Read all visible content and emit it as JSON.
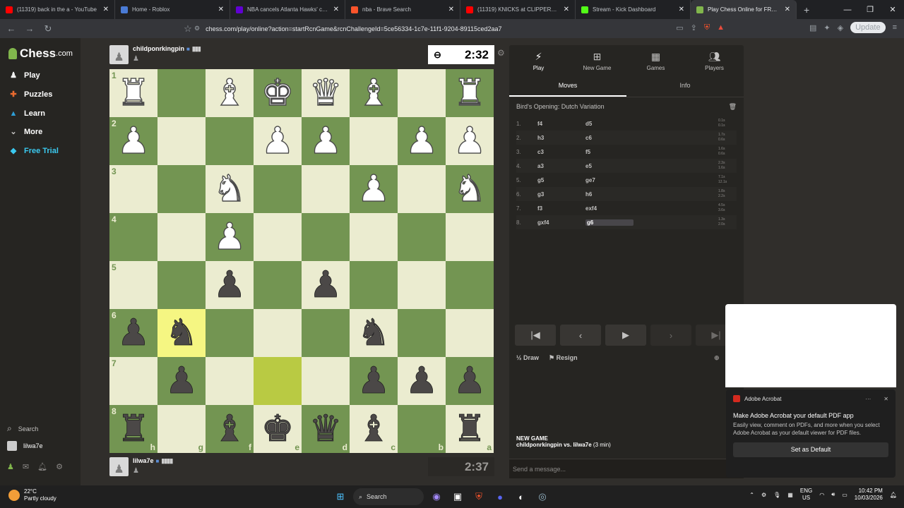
{
  "browser": {
    "tabs": [
      {
        "title": "(11319) back in the a - YouTube",
        "color": "#ff0000",
        "active": false
      },
      {
        "title": "Home - Roblox",
        "color": "#4a7bd6",
        "active": false
      },
      {
        "title": "NBA cancels Atlanta Hawks' controv",
        "color": "#6001d2",
        "active": false
      },
      {
        "title": "nba - Brave Search",
        "color": "#fb542b",
        "active": false
      },
      {
        "title": "(11319) KNICKS at CLIPPERS | FULL G",
        "color": "#ff0000",
        "active": false
      },
      {
        "title": "Stream - Kick Dashboard",
        "color": "#53fc18",
        "active": false
      },
      {
        "title": "Play Chess Online for FREE - 2 P",
        "color": "#81b64c",
        "active": true
      }
    ],
    "url": "chess.com/play/online?action=startRcnGame&rcnChallengeId=5ce56334-1c7e-11f1-9204-89115ced2aa7",
    "update_label": "Update"
  },
  "sidebar": {
    "logo": "Chess",
    "logo_suffix": ".com",
    "items": [
      {
        "label": "Play",
        "icon": "play-icon",
        "color": "#f1f1f1"
      },
      {
        "label": "Puzzles",
        "icon": "puzzle-icon",
        "color": "#e96b2f"
      },
      {
        "label": "Learn",
        "icon": "learn-icon",
        "color": "#2e9ed6"
      },
      {
        "label": "More",
        "icon": "chevron-down-icon",
        "color": "#c3c2c1"
      },
      {
        "label": "Free Trial",
        "icon": "diamond-icon",
        "color": "#3bc9ef"
      }
    ],
    "search_label": "Search",
    "user_label": "lilwa7e"
  },
  "game": {
    "top_player": {
      "name": "childponrkingpin",
      "clock": "2:32"
    },
    "bottom_player": {
      "name": "lilwa7e",
      "clock": "2:37"
    },
    "board": {
      "orientation": "black",
      "ranks": [
        "1",
        "2",
        "3",
        "4",
        "5",
        "6",
        "7",
        "8"
      ],
      "files": [
        "h",
        "g",
        "f",
        "e",
        "d",
        "c",
        "b",
        "a"
      ],
      "last_move": [
        "g6",
        "e7"
      ],
      "rows": [
        [
          "R",
          "",
          "B",
          "K",
          "Q",
          "B",
          "",
          "R"
        ],
        [
          "P",
          "",
          "",
          "P",
          "P",
          "",
          "P",
          "P"
        ],
        [
          "",
          "",
          "N",
          "",
          "",
          "P",
          "",
          "N"
        ],
        [
          "",
          "",
          "P",
          "",
          "",
          "",
          "",
          ""
        ],
        [
          "",
          "",
          "p",
          "",
          "p",
          "",
          "",
          ""
        ],
        [
          "p",
          "n",
          "",
          "",
          "",
          "n",
          "",
          ""
        ],
        [
          "",
          "p",
          "",
          "",
          "",
          "p",
          "p",
          "p"
        ],
        [
          "r",
          "",
          "b",
          "k",
          "q",
          "b",
          "",
          "r"
        ]
      ]
    }
  },
  "panel": {
    "tabs": [
      {
        "label": "Play",
        "icon": "lightning-icon"
      },
      {
        "label": "New Game",
        "icon": "plus-icon"
      },
      {
        "label": "Games",
        "icon": "board-icon"
      },
      {
        "label": "Players",
        "icon": "players-icon"
      }
    ],
    "subtabs": [
      "Moves",
      "Info"
    ],
    "opening": "Bird's Opening: Dutch Variation",
    "moves": [
      {
        "n": "1.",
        "w": "f4",
        "b": "d5",
        "t": [
          "0.1s",
          "0.1s"
        ]
      },
      {
        "n": "2.",
        "w": "h3",
        "b": "c6",
        "t": [
          "1.7s",
          "0.6s"
        ]
      },
      {
        "n": "3.",
        "w": "c3",
        "b": "f5",
        "t": [
          "1.6s",
          "0.6s"
        ]
      },
      {
        "n": "4.",
        "w": "a3",
        "b": "e5",
        "t": [
          "2.3s",
          "1.6s"
        ]
      },
      {
        "n": "5.",
        "w": "g5",
        "b": "ge7",
        "t": [
          "7.1s",
          "12.1s"
        ]
      },
      {
        "n": "6.",
        "w": "g3",
        "b": "h6",
        "t": [
          "1.8s",
          "2.2s"
        ]
      },
      {
        "n": "7.",
        "w": "f3",
        "b": "exf4",
        "t": [
          "4.5s",
          "3.6s"
        ]
      },
      {
        "n": "8.",
        "w": "gxf4",
        "b": "g6",
        "t": [
          "1.3s",
          "2.0s"
        ]
      }
    ],
    "draw_label": "Draw",
    "resign_label": "Resign",
    "new_game_title": "NEW GAME",
    "new_game_players": "childponrkingpin vs. lilwa7e",
    "new_game_time": "(3 min)",
    "message_placeholder": "Send a message..."
  },
  "toast": {
    "app": "Adobe Acrobat",
    "title": "Make Adobe Acrobat your default PDF app",
    "body": "Easily view, comment on PDFs, and more when you select Adobe Acrobat as your default viewer for PDF files.",
    "button": "Set as Default"
  },
  "taskbar": {
    "temp": "22°C",
    "weather": "Partly cloudy",
    "search_label": "Search",
    "lang1": "ENG",
    "lang2": "US",
    "time": "10:42 PM",
    "date": "10/03/2026"
  }
}
